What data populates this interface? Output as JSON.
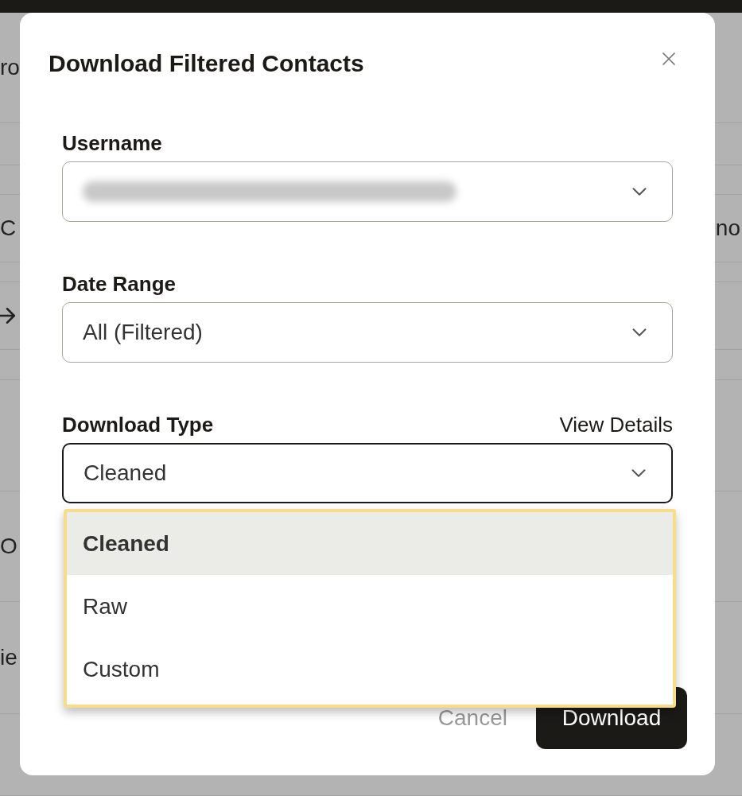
{
  "backdrop": {
    "rows": [
      {
        "left": "ro",
        "right": ""
      },
      {
        "left": "",
        "right": ""
      },
      {
        "left": "",
        "right": ""
      },
      {
        "left": "C",
        "right": "no"
      },
      {
        "left": "",
        "right": ""
      },
      {
        "left": "",
        "right": "",
        "icon": true
      },
      {
        "left": "",
        "right": ""
      },
      {
        "left": "",
        "right": ""
      },
      {
        "left": "O",
        "right": ""
      },
      {
        "left": "ie",
        "right": ""
      },
      {
        "left": "",
        "right": ""
      }
    ]
  },
  "dialog": {
    "title": "Download Filtered Contacts",
    "fields": [
      {
        "label": "Username",
        "kind": "blurred",
        "focused": false
      },
      {
        "label": "Date Range",
        "kind": "select",
        "value": "All (Filtered)",
        "focused": false
      },
      {
        "label": "Download Type",
        "kind": "select",
        "value": "Cleaned",
        "link": "View Details",
        "focused": true
      }
    ],
    "menu": {
      "options": [
        {
          "label": "Cleaned",
          "selected": true
        },
        {
          "label": "Raw",
          "selected": false
        },
        {
          "label": "Custom",
          "selected": false
        }
      ]
    },
    "buttons": {
      "cancel": "Cancel",
      "primary": "Download"
    }
  }
}
